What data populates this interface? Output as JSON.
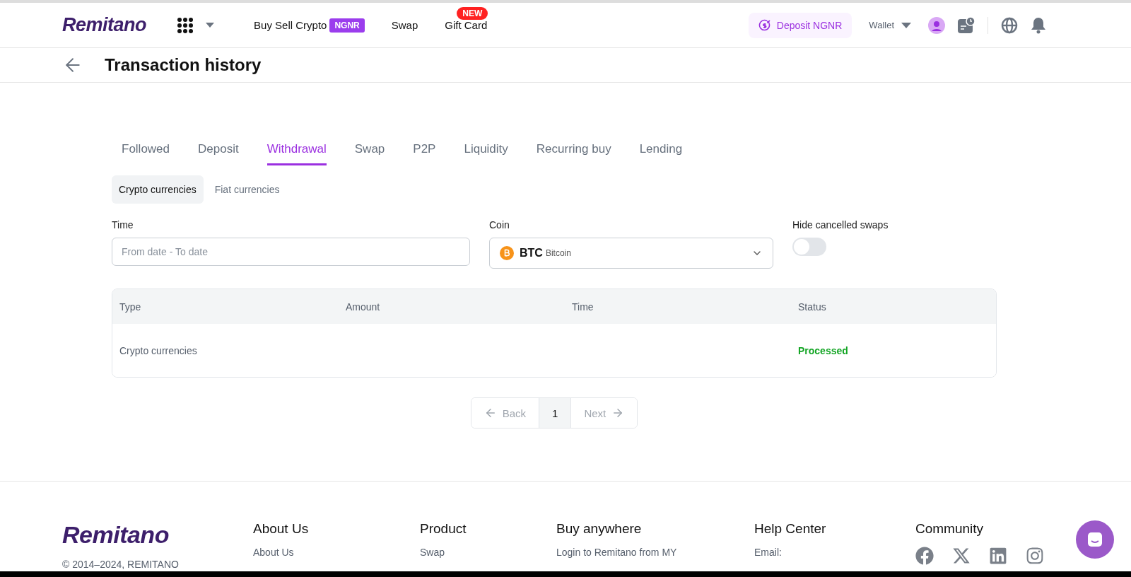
{
  "header": {
    "logo": "Remitano",
    "nav": [
      {
        "label": "Buy Sell Crypto",
        "tag": "NGNR"
      },
      {
        "label": "Swap"
      },
      {
        "label": "Gift Card",
        "new_badge": "NEW"
      }
    ],
    "deposit_button": "Deposit NGNR",
    "wallet": "Wallet"
  },
  "page": {
    "title": "Transaction history"
  },
  "tabs": [
    {
      "label": "Followed",
      "selected": false
    },
    {
      "label": "Deposit",
      "selected": false
    },
    {
      "label": "Withdrawal",
      "selected": true
    },
    {
      "label": "Swap",
      "selected": false
    },
    {
      "label": "P2P",
      "selected": false
    },
    {
      "label": "Liquidity",
      "selected": false
    },
    {
      "label": "Recurring buy",
      "selected": false
    },
    {
      "label": "Lending",
      "selected": false
    }
  ],
  "subtabs": [
    {
      "label": "Crypto currencies",
      "selected": true
    },
    {
      "label": "Fiat currencies",
      "selected": false
    }
  ],
  "filters": {
    "time": {
      "label": "Time",
      "placeholder": "From date - To date"
    },
    "coin": {
      "label": "Coin",
      "symbol": "BTC",
      "name": "Bitcoin"
    },
    "hide_cancelled": {
      "label": "Hide cancelled swaps",
      "on": false
    }
  },
  "table": {
    "columns": [
      "Type",
      "Amount",
      "Time",
      "Status"
    ],
    "rows": [
      {
        "type": "Crypto currencies",
        "status": "Processed"
      }
    ]
  },
  "pagination": {
    "back": "Back",
    "pages": [
      {
        "label": "1",
        "selected": true
      }
    ],
    "next": "Next"
  },
  "footer": {
    "logo": "Remitano",
    "copyright": "© 2014–2024, REMITANO",
    "columns": [
      {
        "title": "About Us",
        "links": [
          "About Us"
        ]
      },
      {
        "title": "Product",
        "links": [
          "Swap"
        ]
      },
      {
        "title": "Buy anywhere",
        "links": [
          "Login to Remitano from MY"
        ]
      },
      {
        "title": "Help Center",
        "links": [
          "Email:"
        ]
      },
      {
        "title": "Community",
        "social": true
      }
    ]
  }
}
